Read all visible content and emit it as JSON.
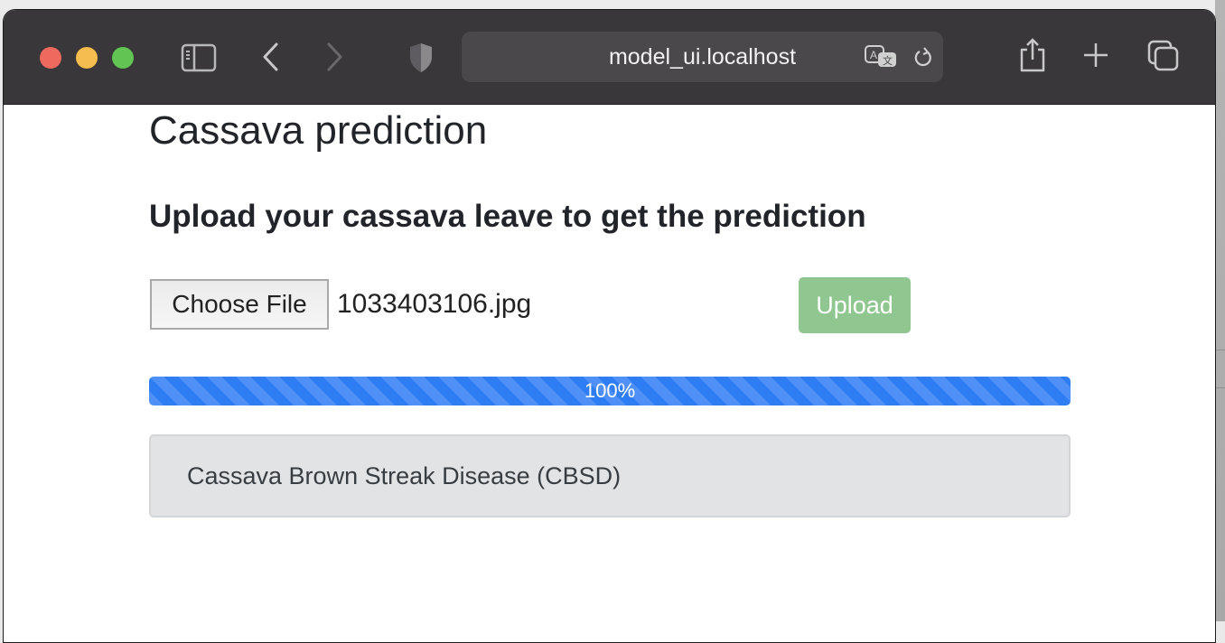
{
  "browser": {
    "address": "model_ui.localhost",
    "icons": [
      "sidebar-icon",
      "back-icon",
      "forward-icon",
      "shield-icon",
      "translate-icon",
      "reload-icon",
      "share-icon",
      "new-tab-icon",
      "tabs-overview-icon"
    ]
  },
  "page": {
    "title": "Cassava prediction",
    "subtitle": "Upload your cassava leave to get the prediction",
    "file_input": {
      "button_label": "Choose File",
      "selected_file": "1033403106.jpg"
    },
    "upload_button": "Upload",
    "progress": {
      "value_percent": 100,
      "label": "100%"
    },
    "result": "Cassava Brown Streak Disease (CBSD)"
  },
  "colors": {
    "upload_button": "#90c690",
    "progress": "#2f7df3",
    "result_bg": "#e2e3e5",
    "toolbar": "#39373a"
  }
}
